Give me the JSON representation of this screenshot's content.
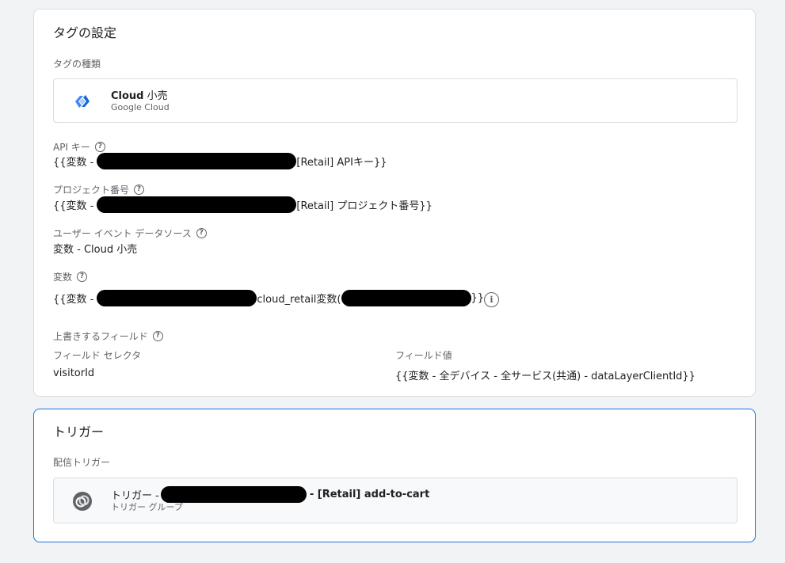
{
  "tag_config": {
    "title": "タグの設定",
    "tag_type_label": "タグの種類",
    "tag_type": {
      "name_bold": "Cloud",
      "name_rest": " 小売",
      "provider": "Google Cloud",
      "icon": "google-cloud-retail-icon"
    },
    "api_key": {
      "label": "API キー",
      "prefix": "{{変数 -",
      "suffix": "[Retail] APIキー}}"
    },
    "project_number": {
      "label": "プロジェクト番号",
      "prefix": "{{変数 -",
      "suffix": "[Retail] プロジェクト番号}}"
    },
    "user_event_source": {
      "label": "ユーザー イベント データソース",
      "value": "変数 - Cloud 小売"
    },
    "variable": {
      "label": "変数",
      "prefix": "{{変数 -",
      "middle": "cloud_retail変数(",
      "suffix": "}}"
    },
    "override_fields": {
      "label": "上書きするフィールド",
      "col_selector": "フィールド セレクタ",
      "col_value": "フィールド値",
      "rows": [
        {
          "selector": "visitorId",
          "value": "{{変数 - 全デバイス - 全サービス(共通) - dataLayerClientId}}"
        }
      ]
    }
  },
  "triggers": {
    "title": "トリガー",
    "firing_label": "配信トリガー",
    "trigger": {
      "name_prefix": "トリガー -",
      "name_suffix": "- [Retail] add-to-cart",
      "subtitle": "トリガー グループ",
      "icon": "trigger-group-icon"
    }
  },
  "icons": {
    "help": "help-icon",
    "info": "info-icon"
  },
  "colors": {
    "accent": "#1a73e8",
    "cloud_blue": "#4285f4",
    "trigger_icon": "#5f6368"
  }
}
